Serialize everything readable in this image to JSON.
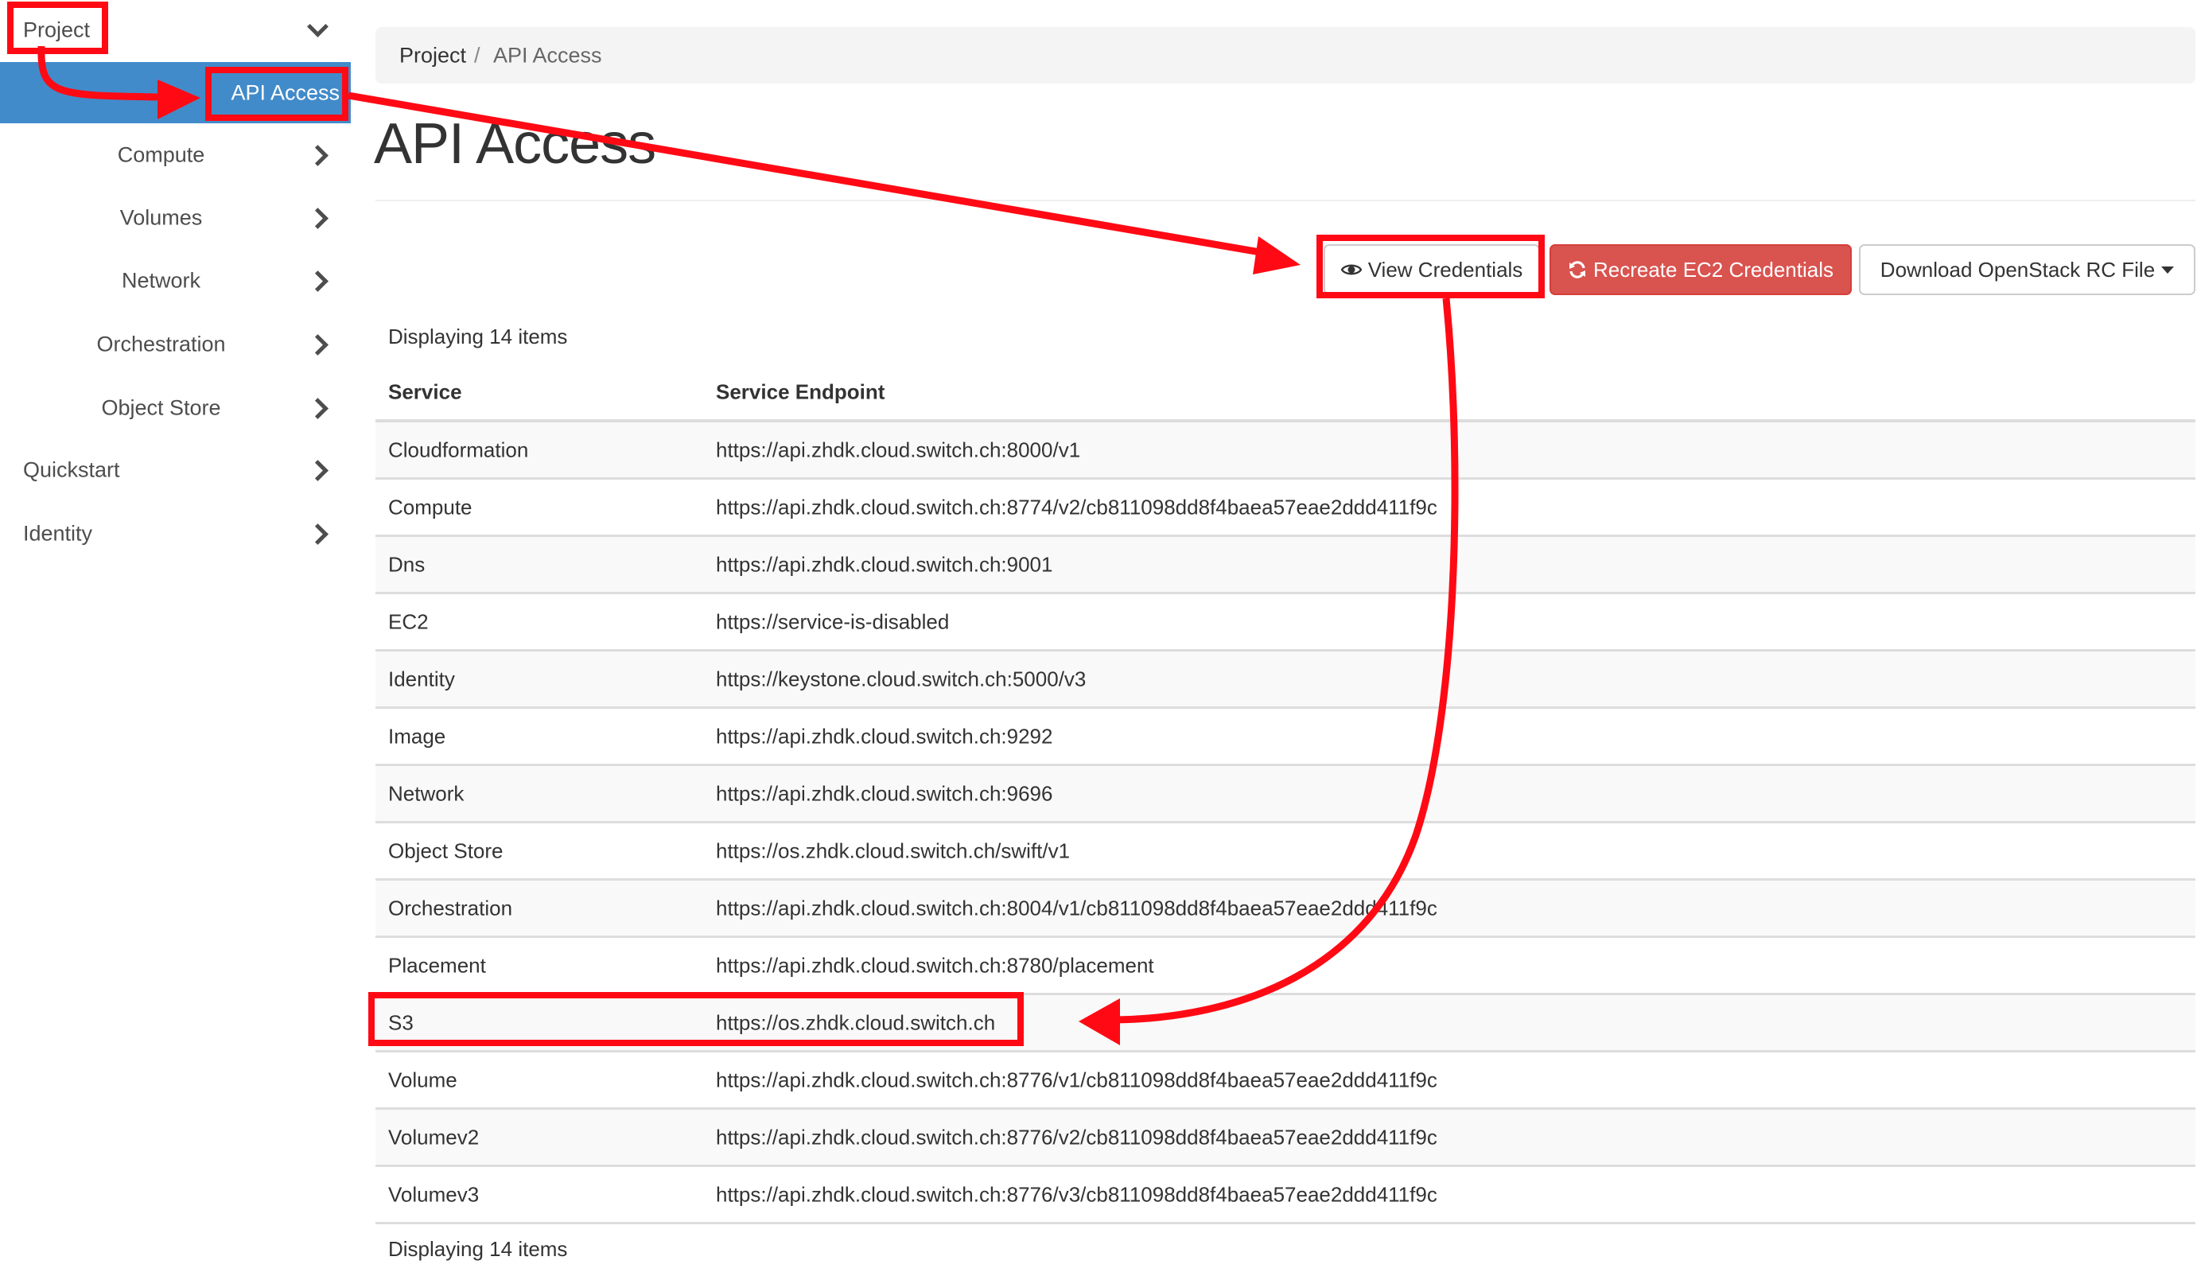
{
  "sidebar": {
    "project_label": "Project",
    "active_item": "API Access",
    "sub_items": [
      {
        "label": "Compute"
      },
      {
        "label": "Volumes"
      },
      {
        "label": "Network"
      },
      {
        "label": "Orchestration"
      },
      {
        "label": "Object Store"
      }
    ],
    "top_items": [
      {
        "label": "Quickstart"
      },
      {
        "label": "Identity"
      }
    ]
  },
  "breadcrumb": {
    "project": "Project",
    "separator": "/",
    "current": "API Access"
  },
  "page": {
    "title": "API Access"
  },
  "toolbar": {
    "view_credentials": "View Credentials",
    "recreate_ec2": "Recreate EC2 Credentials",
    "download_rc": "Download OpenStack RC File"
  },
  "table": {
    "count_text": "Displaying 14 items",
    "headers": {
      "service": "Service",
      "endpoint": "Service Endpoint"
    },
    "rows": [
      {
        "service": "Cloudformation",
        "endpoint": "https://api.zhdk.cloud.switch.ch:8000/v1"
      },
      {
        "service": "Compute",
        "endpoint": "https://api.zhdk.cloud.switch.ch:8774/v2/cb811098dd8f4baea57eae2ddd411f9c"
      },
      {
        "service": "Dns",
        "endpoint": "https://api.zhdk.cloud.switch.ch:9001"
      },
      {
        "service": "EC2",
        "endpoint": "https://service-is-disabled"
      },
      {
        "service": "Identity",
        "endpoint": "https://keystone.cloud.switch.ch:5000/v3"
      },
      {
        "service": "Image",
        "endpoint": "https://api.zhdk.cloud.switch.ch:9292"
      },
      {
        "service": "Network",
        "endpoint": "https://api.zhdk.cloud.switch.ch:9696"
      },
      {
        "service": "Object Store",
        "endpoint": "https://os.zhdk.cloud.switch.ch/swift/v1"
      },
      {
        "service": "Orchestration",
        "endpoint": "https://api.zhdk.cloud.switch.ch:8004/v1/cb811098dd8f4baea57eae2ddd411f9c"
      },
      {
        "service": "Placement",
        "endpoint": "https://api.zhdk.cloud.switch.ch:8780/placement"
      },
      {
        "service": "S3",
        "endpoint": "https://os.zhdk.cloud.switch.ch"
      },
      {
        "service": "Volume",
        "endpoint": "https://api.zhdk.cloud.switch.ch:8776/v1/cb811098dd8f4baea57eae2ddd411f9c"
      },
      {
        "service": "Volumev2",
        "endpoint": "https://api.zhdk.cloud.switch.ch:8776/v2/cb811098dd8f4baea57eae2ddd411f9c"
      },
      {
        "service": "Volumev3",
        "endpoint": "https://api.zhdk.cloud.switch.ch:8776/v3/cb811098dd8f4baea57eae2ddd411f9c"
      }
    ]
  },
  "colors": {
    "active_nav": "#428bca",
    "danger_button": "#d9534f",
    "annotation_red": "#ff0a14"
  }
}
